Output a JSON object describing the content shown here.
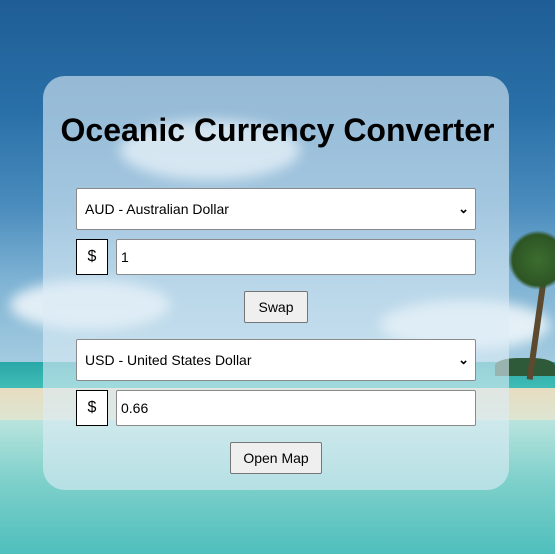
{
  "title": "Oceanic Currency Converter",
  "from": {
    "currency": "AUD - Australian Dollar",
    "symbol": "$",
    "amount": "1"
  },
  "swap_label": "Swap",
  "to": {
    "currency": "USD - United States Dollar",
    "symbol": "$",
    "amount": "0.66"
  },
  "open_map_label": "Open Map",
  "icons": {
    "dropdown": "chevron-down-icon"
  },
  "colors": {
    "card": "#dcecf5",
    "text": "#000000",
    "button_bg": "#efefef"
  }
}
